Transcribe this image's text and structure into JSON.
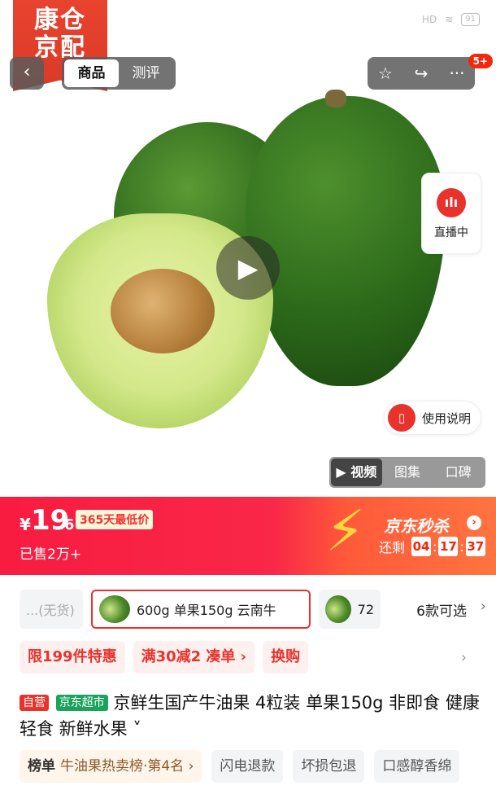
{
  "status_bar": {
    "signal": "HD",
    "battery": "91"
  },
  "logo": {
    "line1": "康仓",
    "line2": "京配"
  },
  "nav": {
    "back_icon": "‹",
    "tabs": [
      "商品",
      "测评"
    ],
    "actions": {
      "favorite": "☆",
      "share": "↪",
      "more": "···"
    },
    "notification_badge": "5+"
  },
  "hero": {
    "play_icon": "▶",
    "live_label": "直播中",
    "manual_label": "使用说明",
    "media_tabs": [
      "▶ 视频",
      "图集",
      "口碑"
    ]
  },
  "price": {
    "currency": "¥",
    "integer": "19",
    "decimal": ".6",
    "low_price_tag": "365天最低价",
    "sold_text": "已售2万+",
    "seckill_title": "京东秒杀",
    "countdown_label": "还剩",
    "countdown": [
      "04",
      "17",
      "37"
    ]
  },
  "skus": [
    {
      "label": "...(无货)",
      "state": "faded"
    },
    {
      "label": "600g 单果150g 云南牛",
      "state": "selected"
    },
    {
      "label": "72",
      "state": "normal"
    }
  ],
  "sku_more": "6款可选",
  "promotions": [
    "限199件特惠",
    "满30减2 凑单 ›",
    "换购"
  ],
  "product": {
    "tag_self": "自营",
    "tag_super": "京东超市",
    "title": "京鲜生国产牛油果 4粒装 单果150g 非即食 健康轻食 新鲜水果 ˅"
  },
  "features": {
    "rank_label": "榜单",
    "rank_text": "牛油果热卖榜·第4名 ›",
    "items": [
      "闪电退款",
      "坏损包退",
      "口感醇香绵"
    ]
  }
}
